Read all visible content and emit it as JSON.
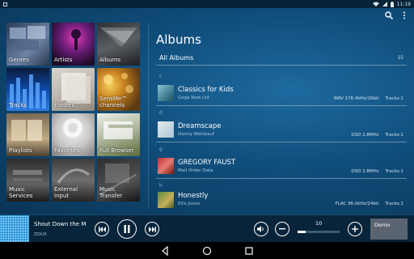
{
  "status_bar": {
    "time": "11:19",
    "icons": [
      "notification-icon",
      "wifi-icon",
      "signal-icon",
      "battery-icon"
    ]
  },
  "header": {
    "title": "Albums",
    "icons": [
      "search-icon",
      "overflow-menu-icon"
    ]
  },
  "tiles": [
    {
      "label": "Genres",
      "icon": "genres-tile-image"
    },
    {
      "label": "Artists",
      "icon": "artists-tile-image"
    },
    {
      "label": "Albums",
      "icon": "albums-tile-image"
    },
    {
      "label": "Tracks",
      "icon": "tracks-tile-image"
    },
    {
      "label": "Folders",
      "icon": "folders-tile-image"
    },
    {
      "label": "SensMe™ channels",
      "icon": "sensme-tile-image"
    },
    {
      "label": "Playlists",
      "icon": "playlists-tile-image"
    },
    {
      "label": "Favorites",
      "icon": "favorites-tile-image"
    },
    {
      "label": "Full Browser",
      "icon": "full-browser-tile-image"
    },
    {
      "label": "Music Services",
      "icon": "music-services-tile-image"
    },
    {
      "label": "External Input",
      "icon": "external-input-tile-image"
    },
    {
      "label": "Music Transfer",
      "icon": "music-transfer-tile-image"
    }
  ],
  "all_albums": {
    "label": "All Albums",
    "count": "15"
  },
  "albums": [
    {
      "section": "c",
      "title": "Classics for Kids",
      "artist": "Gega New Ltd",
      "format": "WAV 176.4kHz/16bit",
      "tracks": "Tracks:1"
    },
    {
      "section": "d",
      "title": "Dreamscape",
      "artist": "Danny Weinkauf",
      "format": "DSD 2.8MHz",
      "tracks": "Tracks:1"
    },
    {
      "section": "g",
      "title": "GREGORY FAUST",
      "artist": "Mail Order Data",
      "format": "DSD 2.8MHz",
      "tracks": "Tracks:1"
    },
    {
      "section": "h",
      "title": "Honestly",
      "artist": "Ellis Jones",
      "format": "FLAC 96.0kHz/24bit",
      "tracks": "Tracks:1"
    }
  ],
  "player": {
    "title": "Shout Down the Moon",
    "artist": "ZOUX",
    "volume": "10",
    "volume_fraction": 0.2,
    "output_label": "Demo"
  },
  "colors": {
    "background": "#0b3a5c",
    "player_bar": "#07243a",
    "accent": "#1f8fd6"
  }
}
